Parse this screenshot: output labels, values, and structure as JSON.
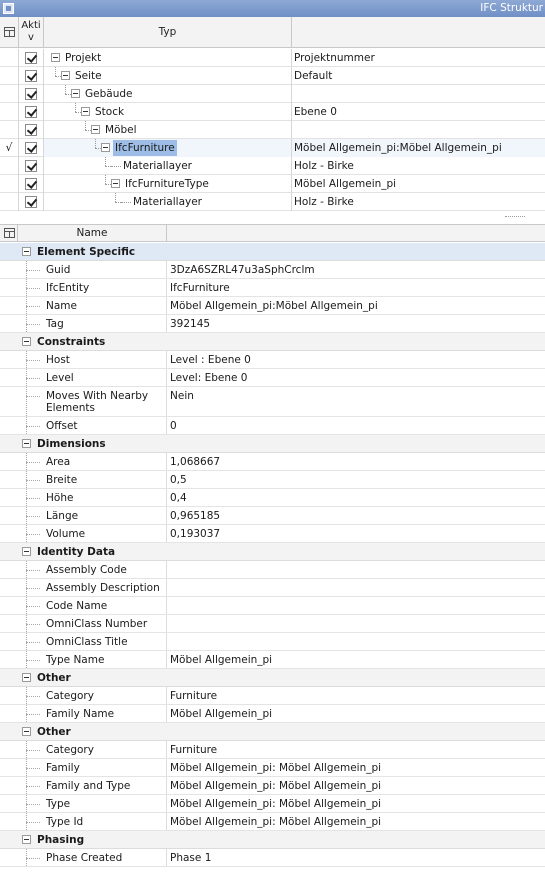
{
  "window": {
    "title": "IFC Struktur"
  },
  "tree": {
    "columns": {
      "aktiv": "Akti v",
      "typ": "Typ",
      "value": ""
    },
    "rows": [
      {
        "label": "Projekt",
        "value": "Projektnummer",
        "check_mark": ""
      },
      {
        "label": "Seite",
        "value": "Default",
        "check_mark": ""
      },
      {
        "label": "Gebäude",
        "value": "",
        "check_mark": ""
      },
      {
        "label": "Stock",
        "value": "Ebene 0",
        "check_mark": ""
      },
      {
        "label": "Möbel",
        "value": "",
        "check_mark": ""
      },
      {
        "label": "IfcFurniture",
        "value": "Möbel Allgemein_pi:Möbel Allgemein_pi",
        "check_mark": "√"
      },
      {
        "label": "Materiallayer",
        "value": "Holz - Birke",
        "check_mark": ""
      },
      {
        "label": "IfcFurnitureType",
        "value": "Möbel Allgemein_pi",
        "check_mark": ""
      },
      {
        "label": "Materiallayer",
        "value": "Holz - Birke",
        "check_mark": ""
      }
    ]
  },
  "properties": {
    "header": {
      "name": "Name"
    },
    "sections": [
      {
        "title": "Element Specific",
        "rows": [
          {
            "name": "Guid",
            "value": "3DzA6SZRL47u3aSphCrclm"
          },
          {
            "name": "IfcEntity",
            "value": "IfcFurniture"
          },
          {
            "name": "Name",
            "value": "Möbel Allgemein_pi:Möbel Allgemein_pi"
          },
          {
            "name": "Tag",
            "value": "392145"
          }
        ]
      },
      {
        "title": "Constraints",
        "rows": [
          {
            "name": "Host",
            "value": "Level : Ebene 0"
          },
          {
            "name": "Level",
            "value": "Level: Ebene 0"
          },
          {
            "name": "Moves With Nearby Elements",
            "value": "Nein"
          },
          {
            "name": "Offset",
            "value": "0"
          }
        ]
      },
      {
        "title": "Dimensions",
        "rows": [
          {
            "name": "Area",
            "value": "1,068667"
          },
          {
            "name": "Breite",
            "value": "0,5"
          },
          {
            "name": "Höhe",
            "value": "0,4"
          },
          {
            "name": "Länge",
            "value": "0,965185"
          },
          {
            "name": "Volume",
            "value": "0,193037"
          }
        ]
      },
      {
        "title": "Identity Data",
        "rows": [
          {
            "name": "Assembly Code",
            "value": ""
          },
          {
            "name": "Assembly Description",
            "value": ""
          },
          {
            "name": "Code Name",
            "value": ""
          },
          {
            "name": "OmniClass Number",
            "value": ""
          },
          {
            "name": "OmniClass Title",
            "value": ""
          },
          {
            "name": "Type Name",
            "value": "Möbel Allgemein_pi"
          }
        ]
      },
      {
        "title": "Other",
        "rows": [
          {
            "name": "Category",
            "value": "Furniture"
          },
          {
            "name": "Family Name",
            "value": "Möbel Allgemein_pi"
          }
        ]
      },
      {
        "title": "Other",
        "rows": [
          {
            "name": "Category",
            "value": "Furniture"
          },
          {
            "name": "Family",
            "value": "Möbel Allgemein_pi: Möbel Allgemein_pi"
          },
          {
            "name": "Family and Type",
            "value": "Möbel Allgemein_pi: Möbel Allgemein_pi"
          },
          {
            "name": "Type",
            "value": "Möbel Allgemein_pi: Möbel Allgemein_pi"
          },
          {
            "name": "Type Id",
            "value": "Möbel Allgemein_pi: Möbel Allgemein_pi"
          }
        ]
      },
      {
        "title": "Phasing",
        "rows": [
          {
            "name": "Phase Created",
            "value": "Phase 1"
          }
        ]
      }
    ]
  }
}
